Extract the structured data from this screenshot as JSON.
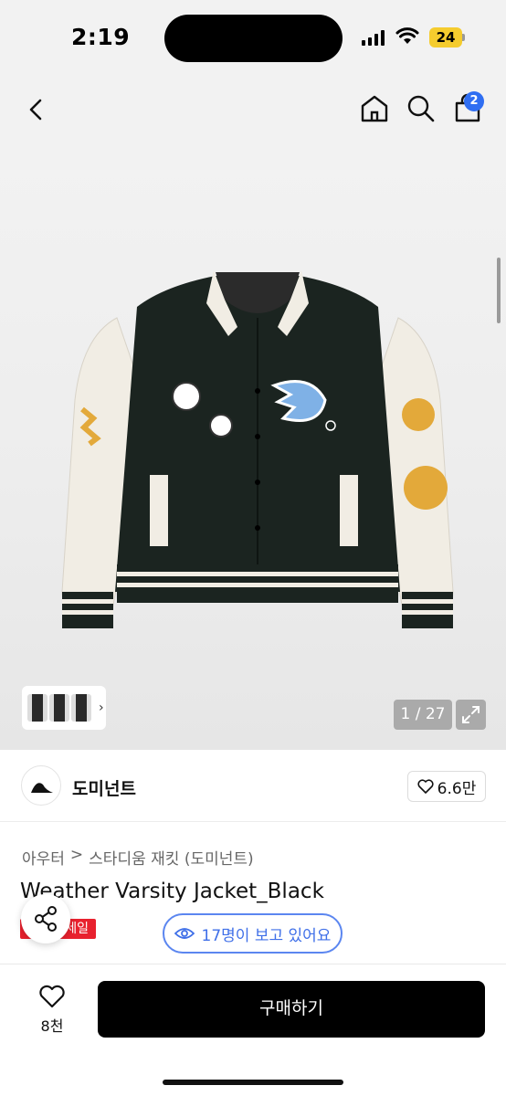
{
  "status": {
    "time": "2:19",
    "battery": "24"
  },
  "nav": {
    "cart_count": "2",
    "icons": [
      "back-icon",
      "home-icon",
      "search-icon",
      "shopping-bag-icon"
    ]
  },
  "gallery": {
    "counter": "1 / 27",
    "thumb_arrow": "›",
    "images": [
      "jacket-front",
      "jacket-front",
      "jacket-back"
    ]
  },
  "brand": {
    "name": "도미넌트",
    "likes": "6.6만"
  },
  "product": {
    "breadcrumb": [
      "아우터",
      ">",
      "스타디움 재킷 (도미넌트)"
    ],
    "title": "Weather Varsity Jacket_Black",
    "sale_badge": "세일",
    "viewers": "17명이 보고 있어요"
  },
  "bottom": {
    "wish_count": "8천",
    "buy_label": "구매하기"
  },
  "colors": {
    "accent_blue": "#3f6fe8",
    "sale_red": "#e8212e",
    "buy_black": "#000000"
  }
}
